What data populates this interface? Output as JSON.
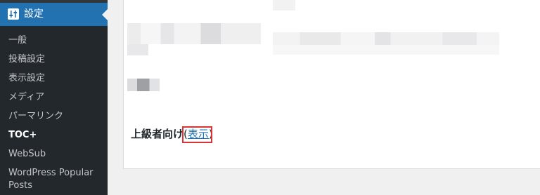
{
  "sidebar": {
    "active": {
      "label": "設定",
      "icon": "settings-sliders-icon"
    },
    "items": [
      {
        "label": "一般"
      },
      {
        "label": "投稿設定"
      },
      {
        "label": "表示設定"
      },
      {
        "label": "メディア"
      },
      {
        "label": "パーマリンク"
      },
      {
        "label": "TOC+"
      },
      {
        "label": "WebSub"
      },
      {
        "label": "WordPress Popular"
      },
      {
        "label": "Posts"
      }
    ]
  },
  "main": {
    "advanced_label": "上級者向け",
    "paren_open": "(",
    "show_link": "表示",
    "paren_close": ")"
  },
  "colors": {
    "sidebar_bg": "#23282d",
    "active_bg": "#2271b1",
    "link": "#2271b1",
    "highlight_border": "#d63638"
  }
}
